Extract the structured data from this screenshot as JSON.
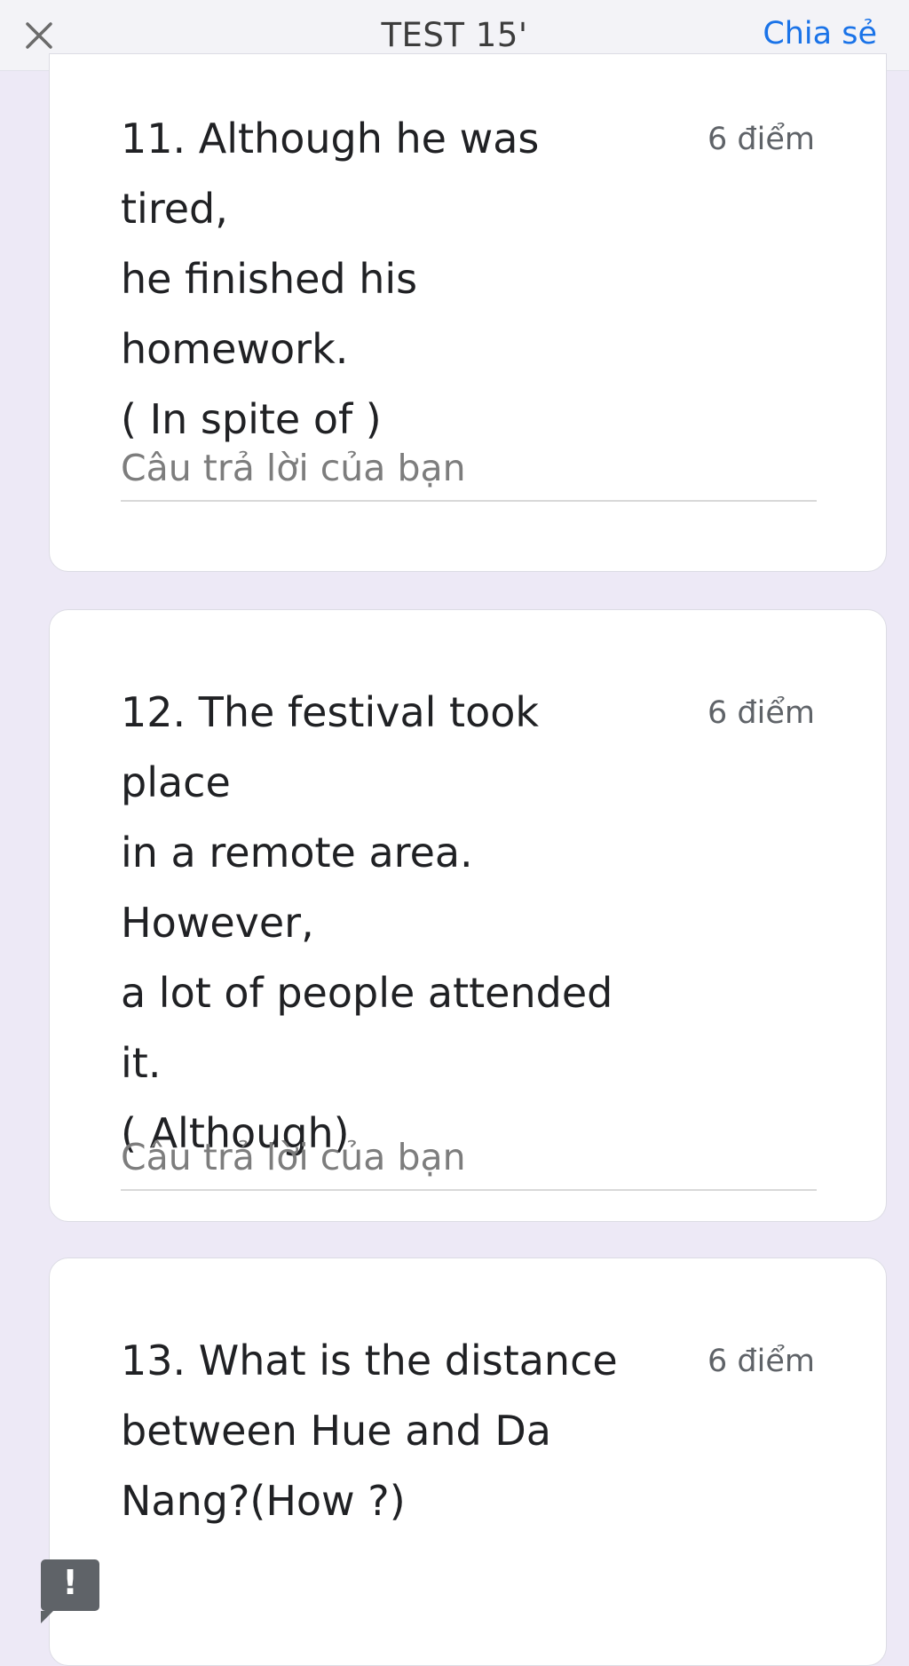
{
  "header": {
    "title": "TEST 15'",
    "share_label": "Chia sẻ",
    "close_icon": "close-icon"
  },
  "questions": [
    {
      "number": 11,
      "text": "11. Although he was tired,\nhe finished his homework.\n( In spite of )",
      "points": "6 điểm",
      "answer_placeholder": "Câu trả lời của bạn",
      "answer_value": ""
    },
    {
      "number": 12,
      "text": "12. The festival took place\nin a remote area. However,\na lot of people attended it.\n( Although)",
      "points": "6 điểm",
      "answer_placeholder": "Câu trả lời của bạn",
      "answer_value": ""
    },
    {
      "number": 13,
      "text": "13. What is the distance\nbetween Hue and Da\nNang?(How ?)",
      "points": "6 điểm"
    }
  ],
  "feedback": {
    "icon": "exclamation-icon",
    "glyph": "!"
  },
  "colors": {
    "background": "#ede9f6",
    "accent": "#1a73e8",
    "card": "#ffffff"
  }
}
